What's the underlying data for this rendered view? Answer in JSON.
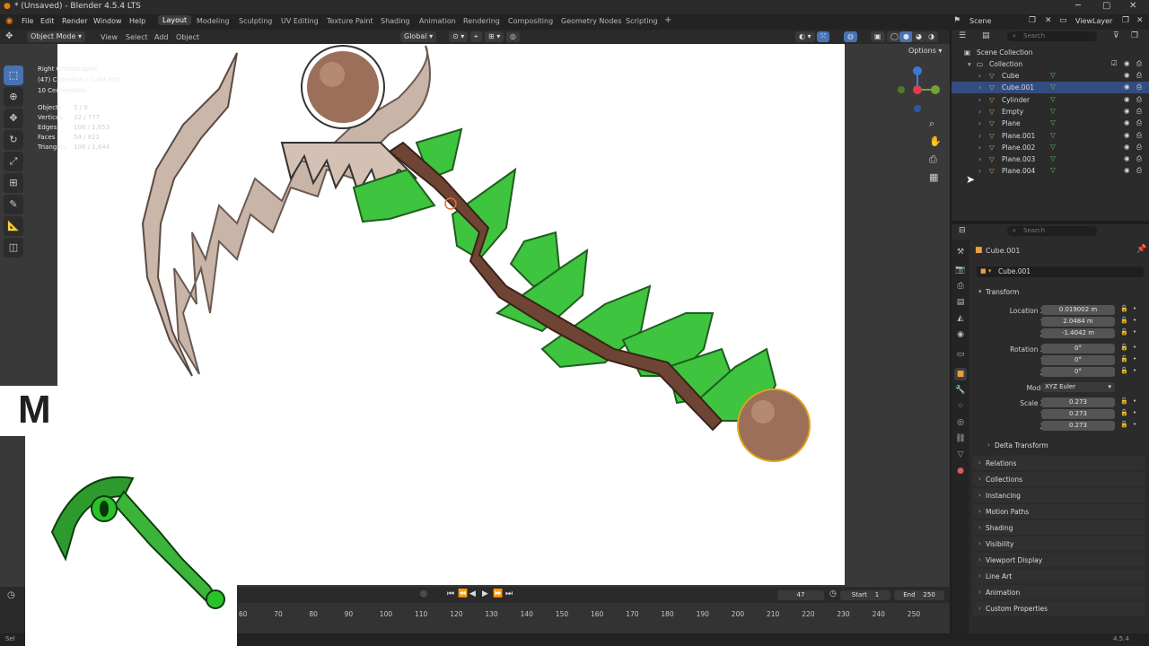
{
  "window": {
    "title": "* (Unsaved) - Blender 4.5.4 LTS",
    "minimize": "─",
    "maximize": "▢",
    "close": "✕"
  },
  "menu": [
    "File",
    "Edit",
    "Render",
    "Window",
    "Help"
  ],
  "workspaces": [
    "Layout",
    "Modeling",
    "Sculpting",
    "UV Editing",
    "Texture Paint",
    "Shading",
    "Animation",
    "Rendering",
    "Compositing",
    "Geometry Nodes",
    "Scripting"
  ],
  "workspace_add": "+",
  "scene": {
    "label": "Scene",
    "viewlayer": "ViewLayer"
  },
  "viewport_header": {
    "mode": "Object Mode",
    "view": "View",
    "select": "Select",
    "add": "Add",
    "object": "Object",
    "orientation": "Global",
    "options": "Options"
  },
  "overlay_stats": {
    "view_name": "Right Orthographic",
    "collection_line": "(47) Collection | Cube.001",
    "units": "10 Centimeters",
    "rows": [
      {
        "label": "Objects",
        "value": "1 / 9"
      },
      {
        "label": "Vertices",
        "value": "32 / 777"
      },
      {
        "label": "Edges",
        "value": "108 / 1,653"
      },
      {
        "label": "Faces",
        "value": "54 / 822"
      },
      {
        "label": "Triangles",
        "value": "108 / 1,644"
      }
    ]
  },
  "overlay_text": "M",
  "outliner": {
    "search_placeholder": "Search",
    "root": "Scene Collection",
    "collection": "Collection",
    "items": [
      {
        "name": "Cube",
        "selected": false
      },
      {
        "name": "Cube.001",
        "selected": true
      },
      {
        "name": "Cylinder",
        "selected": false
      },
      {
        "name": "Empty",
        "selected": false
      },
      {
        "name": "Plane",
        "selected": false
      },
      {
        "name": "Plane.001",
        "selected": false
      },
      {
        "name": "Plane.002",
        "selected": false
      },
      {
        "name": "Plane.003",
        "selected": false
      },
      {
        "name": "Plane.004",
        "selected": false
      }
    ]
  },
  "properties": {
    "search_placeholder": "Search",
    "object_name": "Cube.001",
    "object_field": "Cube.001",
    "transform": {
      "header": "Transform",
      "location_label": "Location X",
      "loc_x": "0.019002 m",
      "loc_y": "2.0484 m",
      "loc_z": "-1.4042 m",
      "rotation_label": "Rotation X",
      "rot_x": "0°",
      "rot_y": "0°",
      "rot_z": "0°",
      "mode_label": "Mode",
      "mode": "XYZ Euler",
      "scale_label": "Scale X",
      "scale_x": "0.273",
      "scale_y": "0.273",
      "scale_z": "0.273",
      "y": "Y",
      "z": "Z"
    },
    "delta_transform": "Delta Transform",
    "panels": [
      "Relations",
      "Collections",
      "Instancing",
      "Motion Paths",
      "Shading",
      "Visibility",
      "Viewport Display",
      "Line Art",
      "Animation",
      "Custom Properties"
    ]
  },
  "timeline": {
    "current_frame": "47",
    "start_label": "Start",
    "start": "1",
    "end_label": "End",
    "end": "250",
    "ticks": [
      "60",
      "70",
      "80",
      "90",
      "100",
      "110",
      "120",
      "130",
      "140",
      "150",
      "160",
      "170",
      "180",
      "190",
      "200",
      "210",
      "220",
      "230",
      "240",
      "250"
    ]
  },
  "status": {
    "left": "Sel",
    "version": "4.5.4"
  },
  "colors": {
    "accent": "#4772b3",
    "selected_row": "#334d80",
    "viewport_bg": "#393939",
    "handle": "#6b4231",
    "leaf": "#3cc43c",
    "blade": "#c7b2a5"
  }
}
